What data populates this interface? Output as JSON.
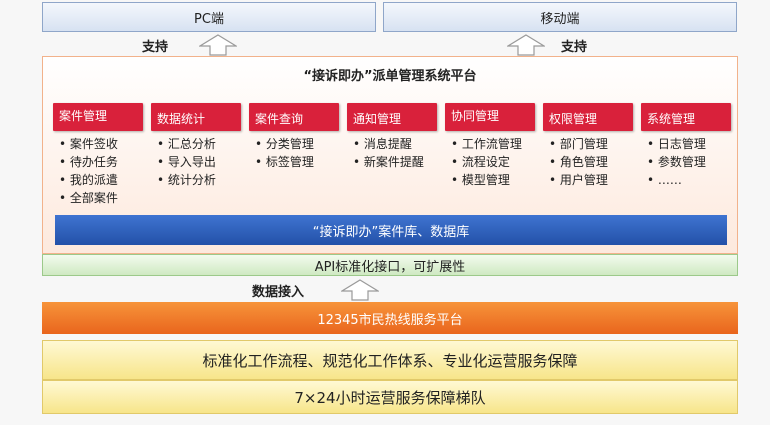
{
  "clients": {
    "pc": "PC端",
    "mobile": "移动端"
  },
  "support_labels": {
    "left": "支持",
    "right": "支持"
  },
  "platform": {
    "title": "“接诉即办”派单管理系统平台",
    "modules": [
      {
        "title": "案件管理",
        "items": [
          "案件签收",
          "待办任务",
          "我的派遣",
          "全部案件"
        ]
      },
      {
        "title": "数据统计",
        "items": [
          "汇总分析",
          "导入导出",
          "统计分析"
        ]
      },
      {
        "title": "案件查询",
        "items": [
          "分类管理",
          "标签管理"
        ]
      },
      {
        "title": "通知管理",
        "items": [
          "消息提醒",
          "新案件提醒"
        ]
      },
      {
        "title": "协同管理",
        "items": [
          "工作流管理",
          "流程设定",
          "模型管理"
        ]
      },
      {
        "title": "权限管理",
        "items": [
          "部门管理",
          "角色管理",
          "用户管理"
        ]
      },
      {
        "title": "系统管理",
        "items": [
          "日志管理",
          "参数管理",
          "……"
        ]
      }
    ],
    "database": "“接诉即办”案件库、数据库"
  },
  "api": "API标准化接口，可扩展性",
  "data_access": "数据接入",
  "hotline": "12345市民热线服务平台",
  "standards": "标准化工作流程、规范化工作体系、专业化运营服务保障",
  "team": "7×24小时运营服务保障梯队"
}
